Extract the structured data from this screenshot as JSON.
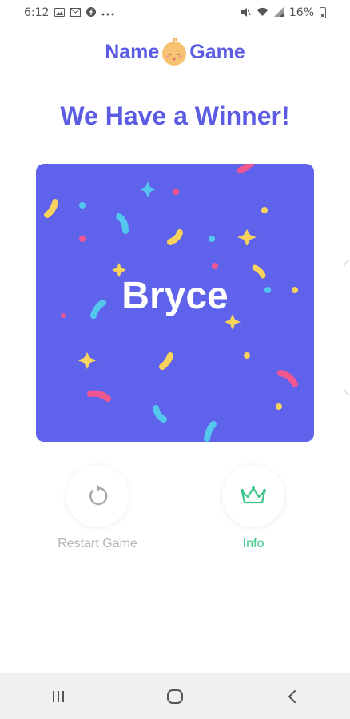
{
  "status_bar": {
    "time": "6:12",
    "battery": "16%",
    "left_icons": [
      "image-icon",
      "mail-icon",
      "facebook-icon",
      "more-icon"
    ],
    "right_icons": [
      "mute-icon",
      "wifi-icon",
      "signal-icon",
      "battery-icon"
    ]
  },
  "logo": {
    "part1": "Name",
    "part2": "Game"
  },
  "heading": "We Have a Winner!",
  "winner": {
    "name": "Bryce",
    "card_color": "#5f62ea"
  },
  "actions": {
    "restart_label": "Restart Game",
    "info_label": "Info"
  },
  "colors": {
    "primary": "#5b5be3",
    "info_green": "#3cc68a",
    "muted": "#b3b3b3"
  },
  "nav_bar": {
    "buttons": [
      "recents",
      "home",
      "back"
    ]
  }
}
